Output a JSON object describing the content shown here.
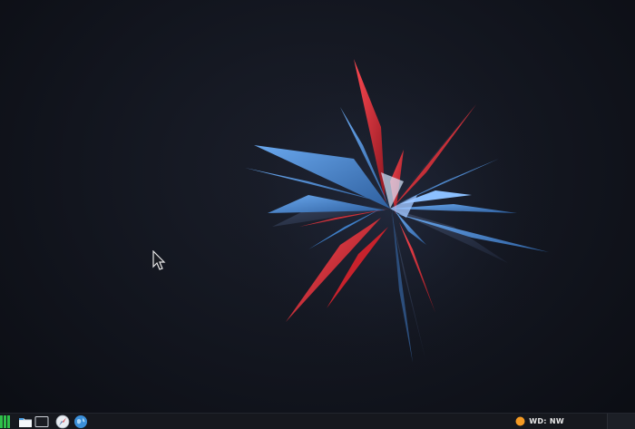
{
  "desktop": {
    "wallpaper": "abstract-crystal-shards",
    "colors": {
      "background": "#12151e",
      "shard_blue": "#4f8fd9",
      "shard_red": "#e2303a",
      "taskbar": "#16181e"
    }
  },
  "taskbar": {
    "launchers": [
      {
        "name": "app-menu",
        "icon": "menu-grid-icon"
      },
      {
        "name": "files",
        "icon": "folder-icon"
      },
      {
        "name": "terminal",
        "icon": "terminal-icon"
      },
      {
        "name": "browser",
        "icon": "compass-icon"
      },
      {
        "name": "browser-2",
        "icon": "globe-icon"
      }
    ],
    "tray": {
      "status_icon": "orange-circle-icon",
      "text": "WD: NW"
    }
  }
}
